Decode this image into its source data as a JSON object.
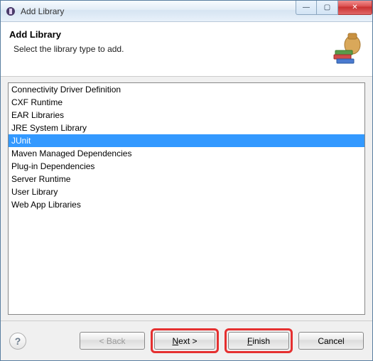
{
  "window": {
    "title": "Add Library"
  },
  "header": {
    "title": "Add Library",
    "subtitle": "Select the library type to add."
  },
  "list": {
    "items": [
      "Connectivity Driver Definition",
      "CXF Runtime",
      "EAR Libraries",
      "JRE System Library",
      "JUnit",
      "Maven Managed Dependencies",
      "Plug-in Dependencies",
      "Server Runtime",
      "User Library",
      "Web App Libraries"
    ],
    "selected_index": 4
  },
  "buttons": {
    "help": "?",
    "back": "< Back",
    "next_prefix": "N",
    "next_rest": "ext >",
    "finish_prefix": "F",
    "finish_rest": "inish",
    "cancel": "Cancel"
  },
  "win_controls": {
    "minimize": "—",
    "maximize": "▢",
    "close": "✕"
  }
}
